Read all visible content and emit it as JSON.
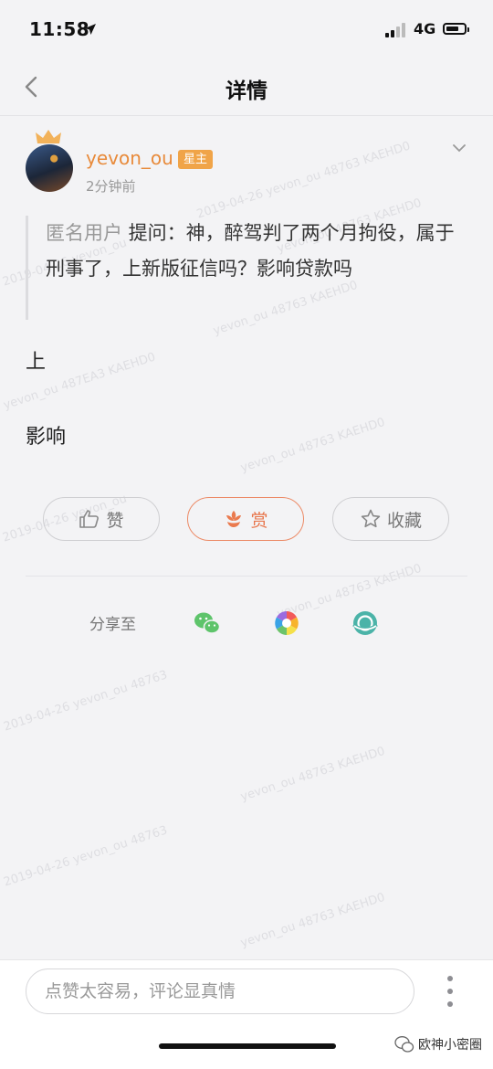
{
  "status_bar": {
    "time": "11:58",
    "network": "4G"
  },
  "nav": {
    "title": "详情"
  },
  "post": {
    "author": "yevon_ou",
    "role_badge": "星主",
    "posted_time": "2分钟前",
    "quote_author": "匿名用户",
    "quote_text": " 提问：神，醉驾判了两个月拘役，属于刑事了，上新版征信吗？影响贷款吗",
    "answer_lines": [
      "上",
      "影响"
    ]
  },
  "actions": {
    "like_label": "赞",
    "reward_label": "赏",
    "favorite_label": "收藏"
  },
  "share": {
    "label": "分享至",
    "targets": [
      "wechat-icon",
      "moments-icon",
      "planet-icon"
    ]
  },
  "comment": {
    "placeholder": "点赞太容易，评论显真情"
  },
  "brand": {
    "name": "欧神小密圈"
  },
  "colors": {
    "accent": "#e88a3a",
    "badge": "#f0a448",
    "reward": "#e8764c",
    "wechat": "#5ec46b",
    "planet": "#4bb3a8"
  }
}
